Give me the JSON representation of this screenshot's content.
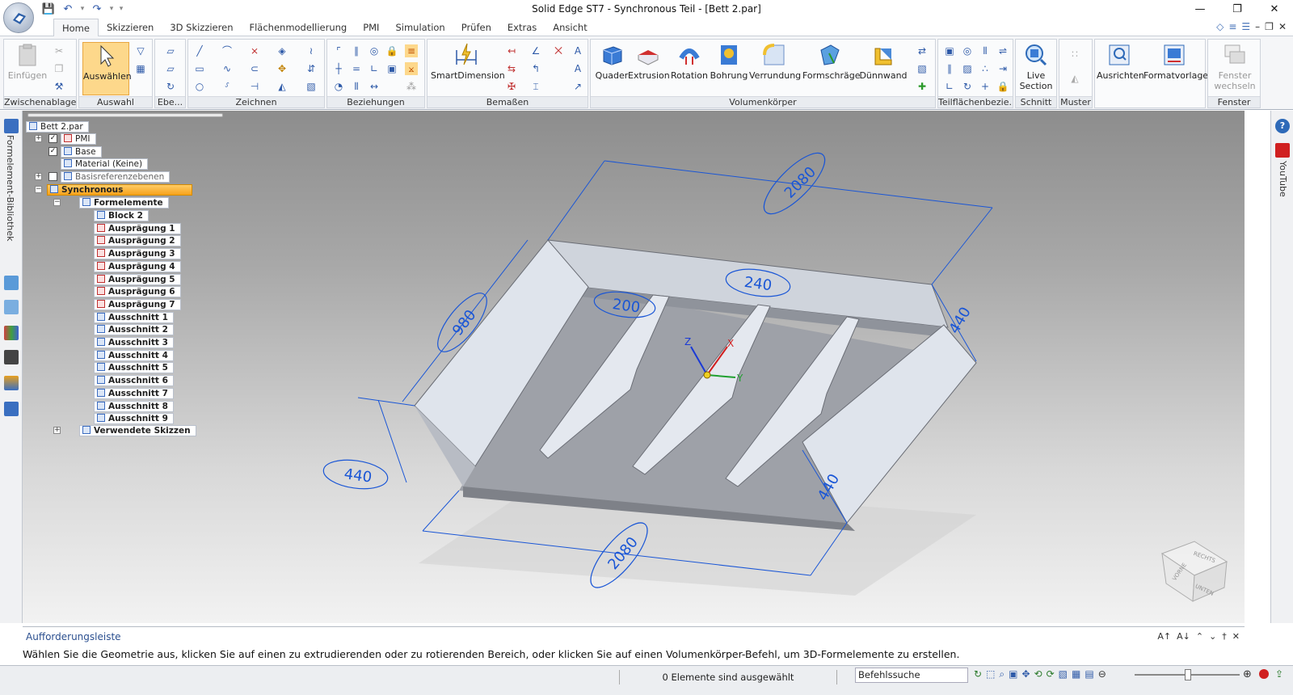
{
  "window": {
    "title": "Solid Edge ST7 - Synchronous Teil - [Bett 2.par]"
  },
  "tabs": [
    "Home",
    "Skizzieren",
    "3D Skizzieren",
    "Flächenmodellierung",
    "PMI",
    "Simulation",
    "Prüfen",
    "Extras",
    "Ansicht"
  ],
  "ribbon": {
    "groups": {
      "zwischenablage": "Zwischenablage",
      "auswahl": "Auswahl",
      "ebe": "Ebe...",
      "zeichnen": "Zeichnen",
      "beziehungen": "Beziehungen",
      "bemassen": "Bemaßen",
      "volumenkoerper": "Volumenkörper",
      "teilflaechen": "Teilflächenbezie...",
      "schnitt": "Schnitt",
      "muster": "Muster",
      "fenster": "Fenster"
    },
    "buttons": {
      "einfuegen": "Einfügen",
      "auswaehlen": "Auswählen",
      "smartdimension": "SmartDimension",
      "quader": "Quader",
      "extrusion": "Extrusion",
      "rotation": "Rotation",
      "bohrung": "Bohrung",
      "verrundung": "Verrundung",
      "formschraege": "Formschräge",
      "duennwand": "Dünnwand",
      "live_section_1": "Live",
      "live_section_2": "Section",
      "ausrichten": "Ausrichten",
      "formatvorlage": "Formatvorlage",
      "fenster_1": "Fenster",
      "fenster_2": "wechseln"
    }
  },
  "left_dock": {
    "label": "Formelement-Bibliothek"
  },
  "right_dock": {
    "label": "YouTube"
  },
  "tree": {
    "root": "Bett 2.par",
    "pmi": "PMI",
    "base": "Base",
    "material": "Material (Keine)",
    "basisreferenzebenen": "Basisreferenzebenen",
    "synchronous": "Synchronous",
    "formelemente": "Formelemente",
    "features": [
      "Block 2",
      "Ausprägung 1",
      "Ausprägung 2",
      "Ausprägung 3",
      "Ausprägung 4",
      "Ausprägung 5",
      "Ausprägung 6",
      "Ausprägung 7",
      "Ausschnitt 1",
      "Ausschnitt 2",
      "Ausschnitt 3",
      "Ausschnitt 4",
      "Ausschnitt 5",
      "Ausschnitt 6",
      "Ausschnitt 7",
      "Ausschnitt 8",
      "Ausschnitt 9"
    ],
    "verwendete_skizzen": "Verwendete Skizzen"
  },
  "dimensions": {
    "top": "2080",
    "left": "980",
    "front_left": "440",
    "bottom": "2080",
    "mid_200": "200",
    "mid_240": "240",
    "right_440a": "440",
    "right_440b": "440"
  },
  "triad": {
    "z": "Z",
    "x": "X",
    "y": "Y"
  },
  "viewcube": {
    "vorne": "VORNE",
    "rechts": "RECHTS",
    "unten": "UNTEN"
  },
  "prompt": {
    "title": "Aufforderungsleiste",
    "message": "Wählen Sie die Geometrie aus, klicken Sie auf einen zu extrudierenden oder zu rotierenden Bereich, oder klicken Sie auf einen Volumenkörper-Befehl, um 3D-Formelemente zu erstellen."
  },
  "status": {
    "selection": "0 Elemente sind ausgewählt",
    "command_search": "Befehlssuche"
  },
  "colors": {
    "dimension": "#1a56d6",
    "highlight": "#f7a21b",
    "face_light": "#dfe4ec",
    "face_dark": "#9ea1a8"
  }
}
